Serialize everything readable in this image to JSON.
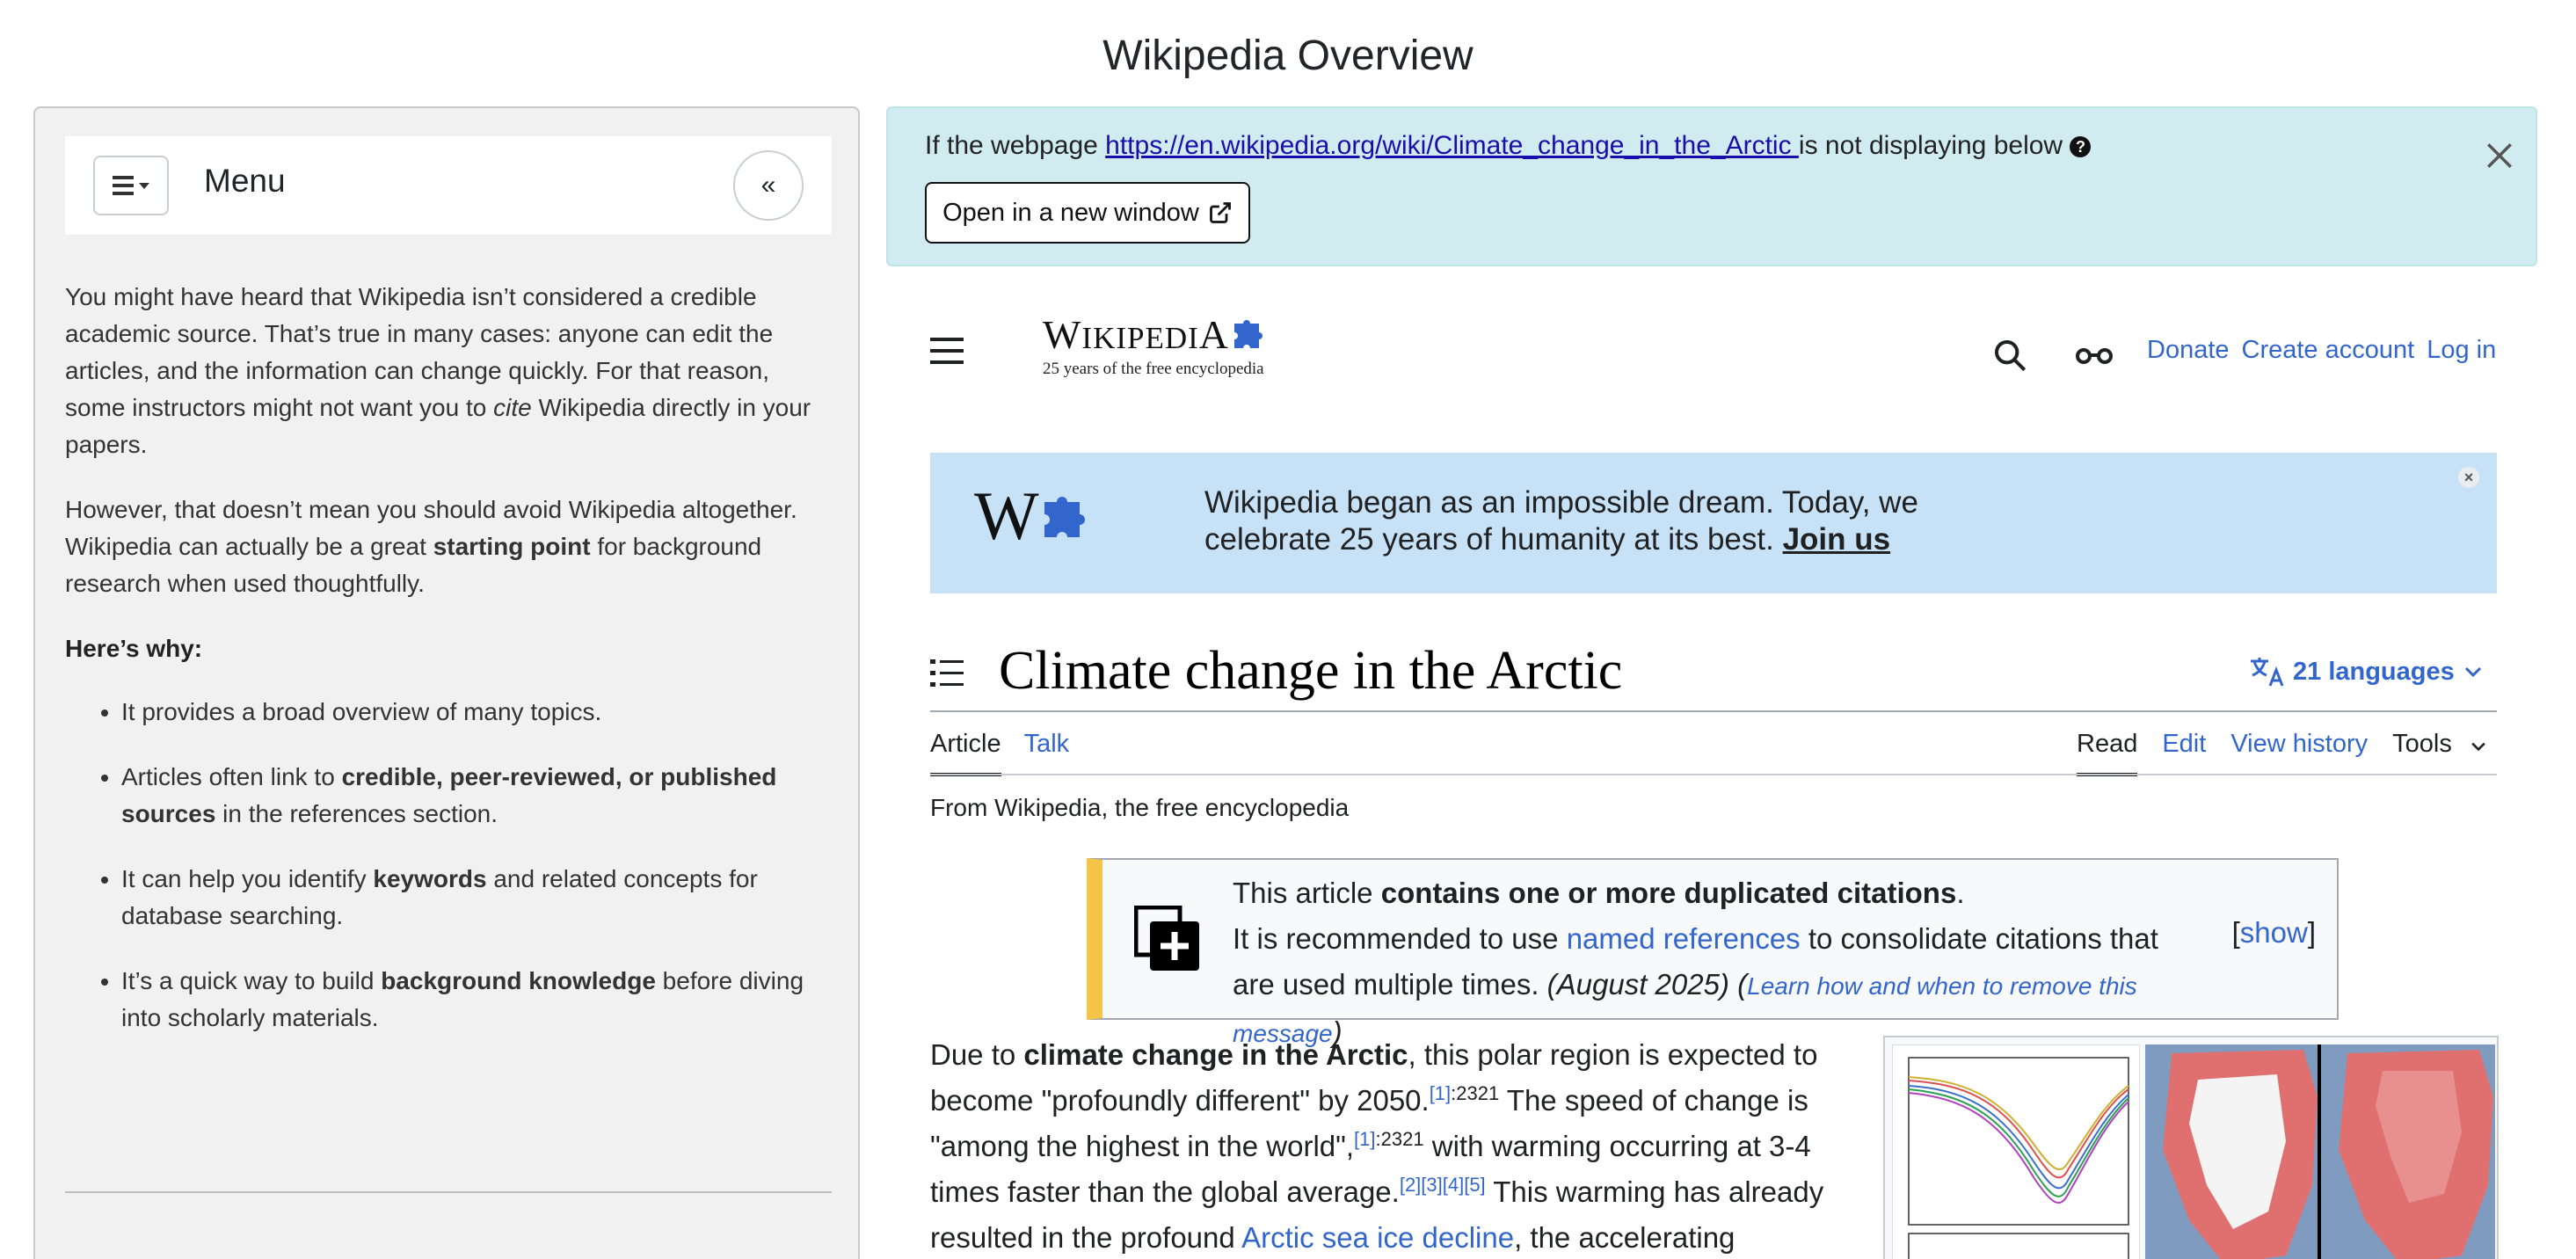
{
  "page": {
    "title": "Wikipedia Overview"
  },
  "sidebar": {
    "menu_label": "Menu",
    "collapse_label": "«",
    "para1_a": "You might have heard that Wikipedia isn’t considered a credible academic source. That’s true in many cases: anyone can edit the articles, and the information can change quickly. For that reason, some instructors might not want you to ",
    "para1_cite": "cite",
    "para1_b": " Wikipedia directly in your papers.",
    "para2_a": "However, that doesn’t mean you should avoid Wikipedia altogether. Wikipedia can actually be a great ",
    "para2_bold": "starting point",
    "para2_b": " for background research when used thoughtfully.",
    "why_heading": "Here’s why:",
    "bullets": {
      "b1": "It provides a broad overview of many topics.",
      "b2_a": "Articles often link to ",
      "b2_bold": "credible, peer-reviewed, or published sources",
      "b2_b": " in the references section.",
      "b3_a": "It can help you identify ",
      "b3_bold": "keywords",
      "b3_b": " and related concepts for database searching.",
      "b4_a": "It’s a quick way to build ",
      "b4_bold": "background knowledge",
      "b4_b": " before diving into scholarly materials."
    }
  },
  "notice": {
    "text_before": "If the webpage ",
    "url": "https://en.wikipedia.org/wiki/Climate_change_in_the_Arctic ",
    "text_after": "is not displaying below",
    "open_button": "Open in a new window",
    "close": "×"
  },
  "wiki": {
    "wordmark_w": "W",
    "wordmark_rest": "IKIPEDI",
    "wordmark_a": "A",
    "tagline": "25 years of the free encyclopedia",
    "links": {
      "donate": "Donate",
      "create_account": "Create account",
      "log_in": "Log in"
    },
    "banner": {
      "line1": "Wikipedia began as an impossible dream. Today, we",
      "line2": "celebrate 25 years of humanity at its best. ",
      "join": "Join us",
      "close": "×"
    },
    "article_title": "Climate change in the Arctic",
    "languages": "21 languages",
    "tabs": {
      "article": "Article",
      "talk": "Talk",
      "read": "Read",
      "edit": "Edit",
      "view_history": "View history",
      "tools": "Tools"
    },
    "from_wiki": "From Wikipedia, the free encyclopedia",
    "ambox": {
      "a": "This article ",
      "bold": "contains one or more duplicated citations",
      "b": ".",
      "c": "It is recommended to use ",
      "link": "named references",
      "d": " to consolidate citations that are used multiple times. ",
      "date": "(August 2025)",
      "e": " (",
      "learn": "Learn how and when to remove this message",
      "f": ")",
      "show_open": "[",
      "show": "show",
      "show_close": "]"
    },
    "body": {
      "a": "Due to ",
      "bold": "climate change in the Arctic",
      "b": ", this polar region is expected to become \"profoundly different\" by 2050.",
      "ref1": "[1]",
      "pg1": ":2321",
      "c": " The speed of change is \"among the highest in the world\",",
      "ref2": "[1]",
      "pg2": ":2321",
      "d": " with warming occurring at 3-4 times faster than the global average.",
      "refs3": "[2][3][4][5]",
      "e": " This warming has already resulted in the profound ",
      "link": "Arctic sea ice decline",
      "f": ", the accelerating melting"
    }
  }
}
